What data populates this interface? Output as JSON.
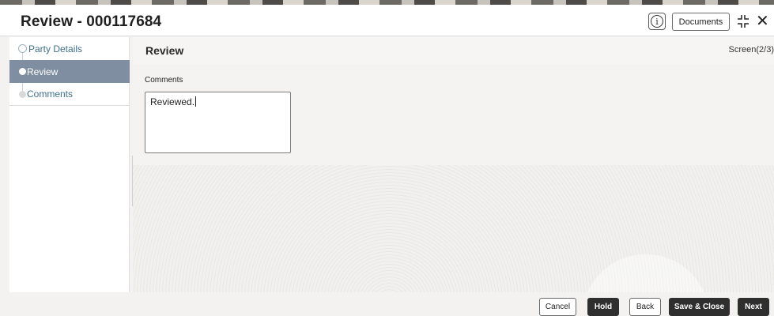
{
  "header": {
    "title": "Review - 000117684",
    "info_icon": "info-icon",
    "documents_label": "Documents",
    "minimize_icon": "minimize-icon",
    "close_glyph": "✕"
  },
  "sidebar": {
    "steps": [
      {
        "label": "Party Details",
        "state": "completed"
      },
      {
        "label": "Review",
        "state": "active"
      },
      {
        "label": "Comments",
        "state": "pending"
      }
    ]
  },
  "main": {
    "title": "Review",
    "screen_indicator": "Screen(2/3)",
    "comments": {
      "label": "Comments",
      "value": "Reviewed."
    }
  },
  "footer": {
    "cancel_label": "Cancel",
    "hold_label": "Hold",
    "back_label": "Back",
    "save_close_label": "Save & Close",
    "next_label": "Next"
  },
  "colors": {
    "active_step_bg": "#7f8ea1",
    "link_text": "#3f6f8a",
    "primary_button": "#2f2f2f"
  }
}
